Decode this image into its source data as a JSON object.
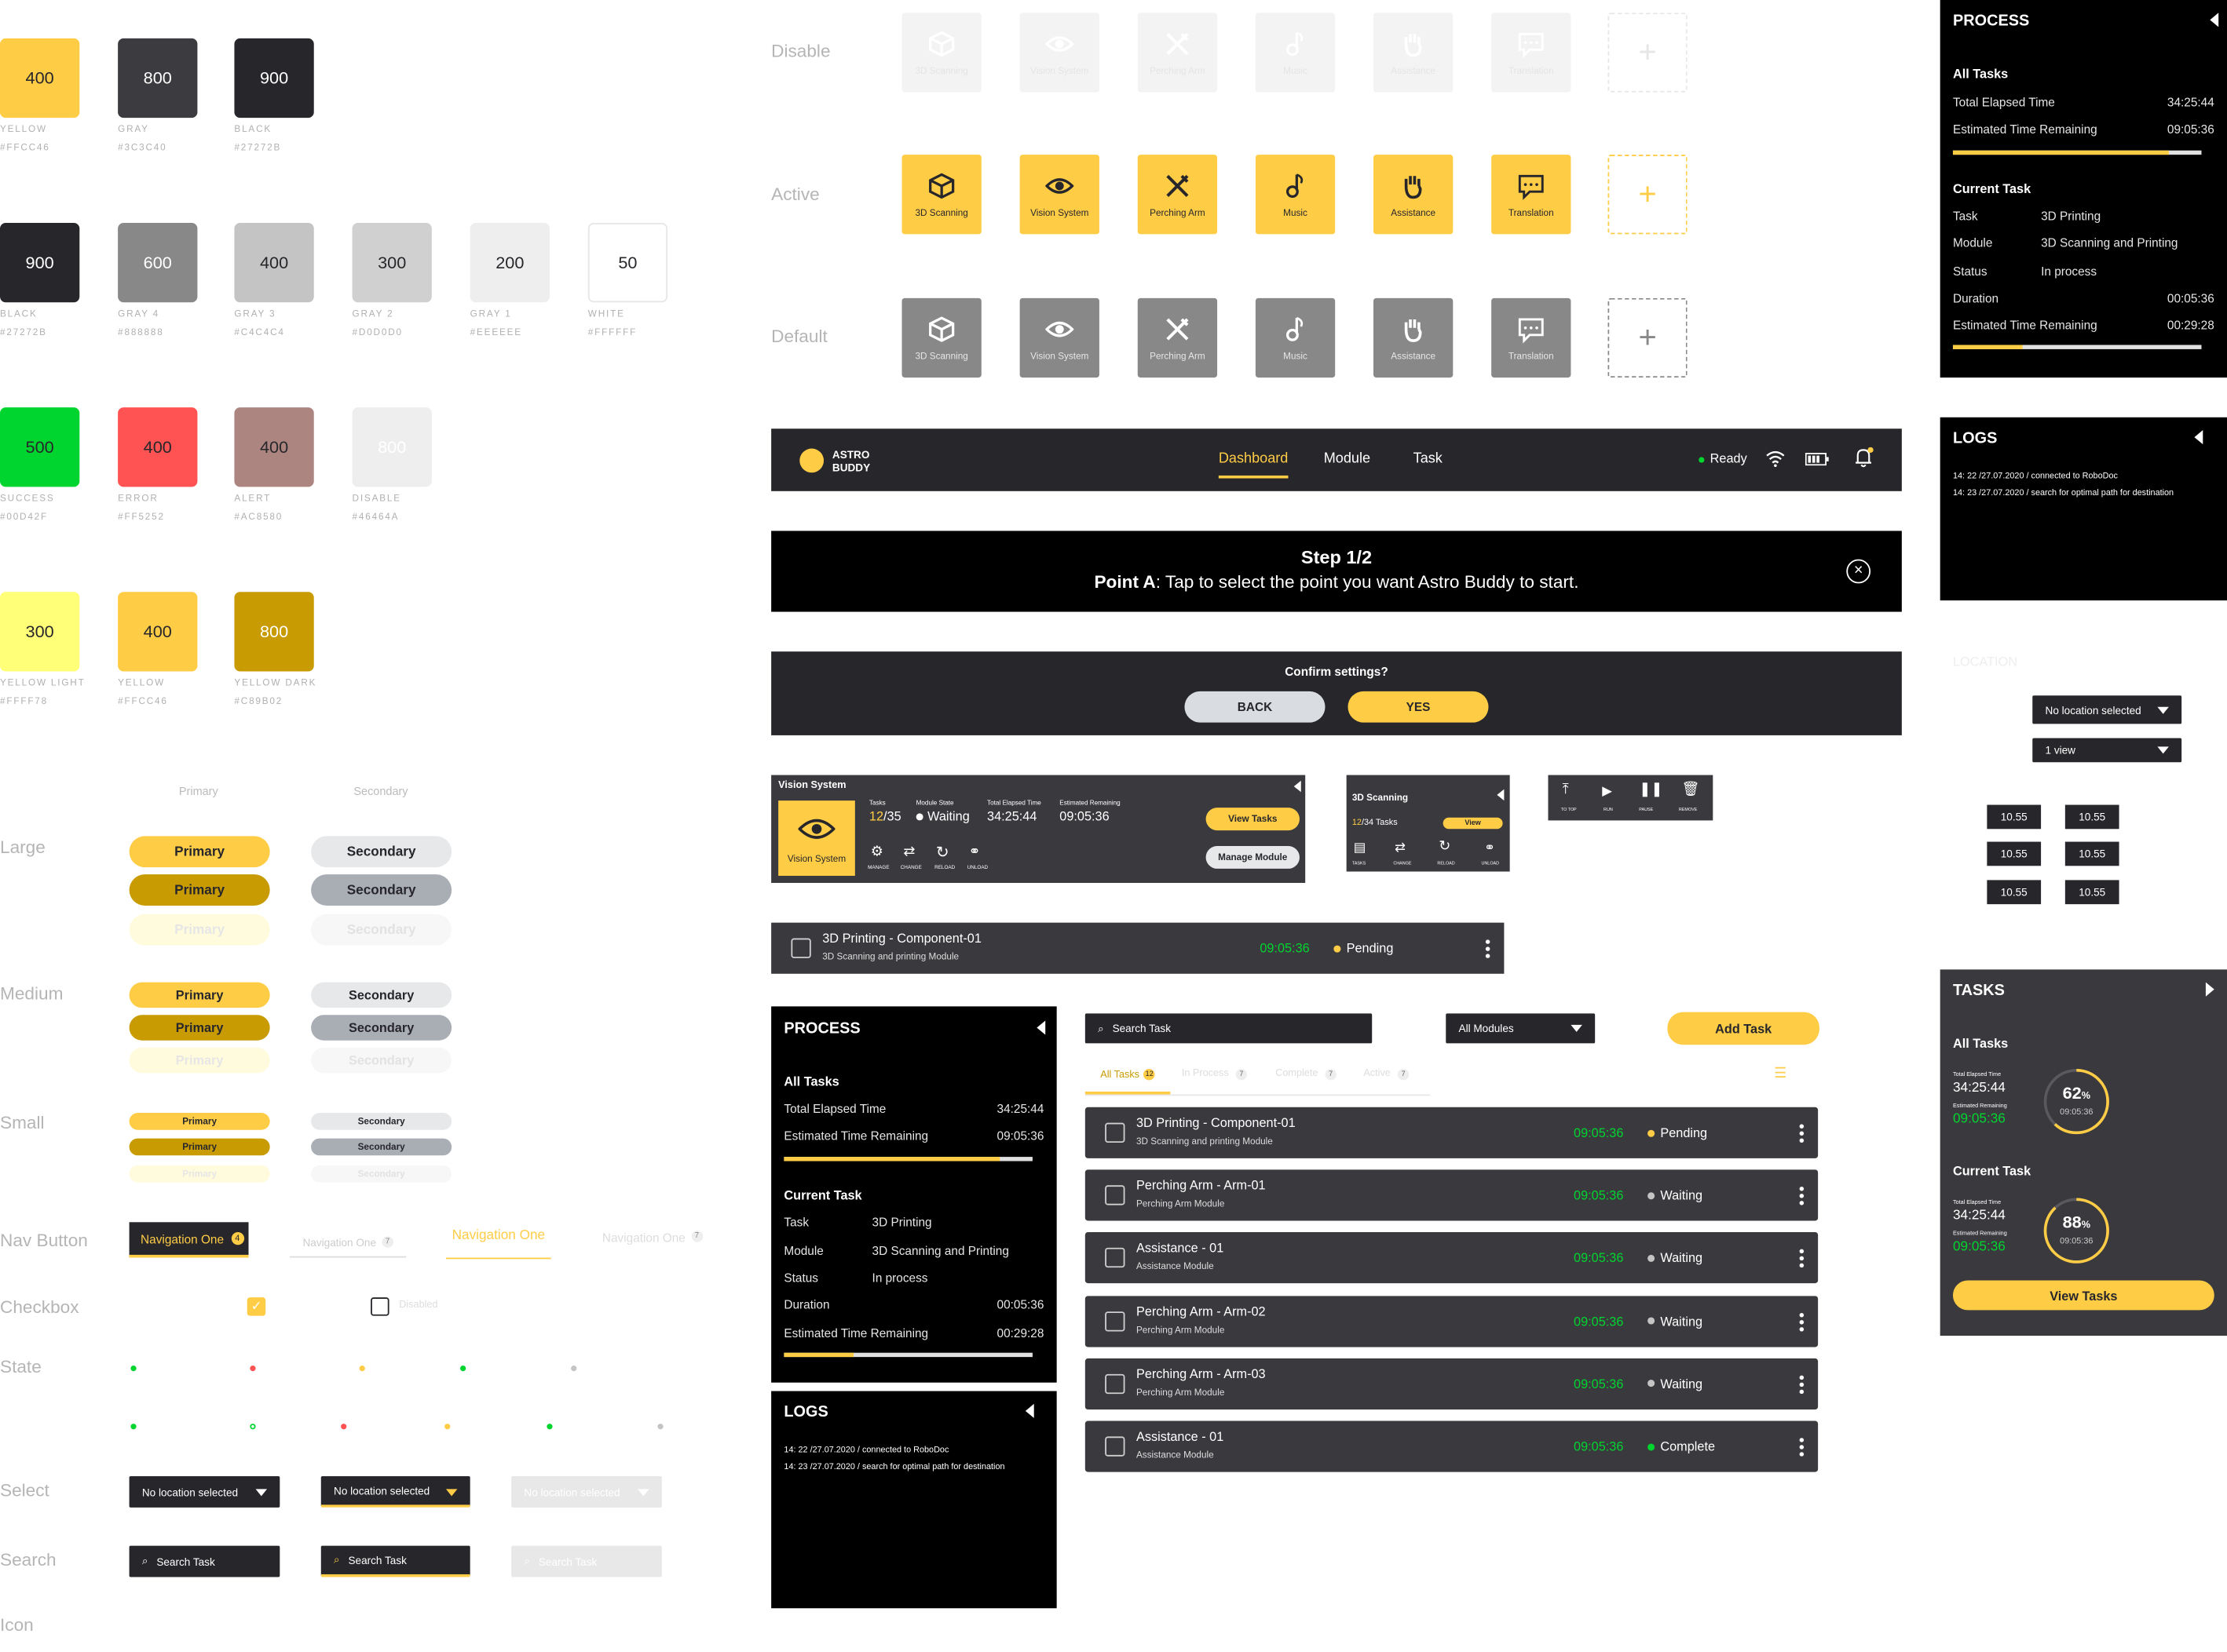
{
  "colors": {
    "yellow": "#FFCC46",
    "gray": "#3C3C40",
    "black": "#27272B",
    "gray4": "#888888",
    "gray3": "#C4C4C4",
    "gray2": "#D0D0D0",
    "gray1": "#EEEEEE",
    "white": "#FFFFFF",
    "success": "#00D42F",
    "error": "#FF5252",
    "alert": "#AC8580",
    "disable": "#46464A",
    "yellow_light": "#FFFF78",
    "yellow_dark": "#C89B02"
  },
  "swatches": [
    {
      "num": "400",
      "name": "YELLOW",
      "hex": "#FFCC46"
    },
    {
      "num": "800",
      "name": "GRAY",
      "hex": "#3C3C40"
    },
    {
      "num": "900",
      "name": "BLACK",
      "hex": "#27272B"
    },
    {
      "num": "900",
      "name": "BLACK",
      "hex": "#27272B"
    },
    {
      "num": "600",
      "name": "GRAY 4",
      "hex": "#888888"
    },
    {
      "num": "400",
      "name": "GRAY 3",
      "hex": "#C4C4C4"
    },
    {
      "num": "300",
      "name": "GRAY 2",
      "hex": "#D0D0D0"
    },
    {
      "num": "200",
      "name": "GRAY 1",
      "hex": "#EEEEEE"
    },
    {
      "num": "50",
      "name": "WHITE",
      "hex": "#FFFFFF"
    },
    {
      "num": "500",
      "name": "SUCCESS",
      "hex": "#00D42F"
    },
    {
      "num": "400",
      "name": "ERROR",
      "hex": "#FF5252"
    },
    {
      "num": "400",
      "name": "ALERT",
      "hex": "#AC8580"
    },
    {
      "num": "800",
      "name": "DISABLE",
      "hex": "#46464A"
    },
    {
      "num": "300",
      "name": "YELLOW LIGHT",
      "hex": "#FFFF78"
    },
    {
      "num": "400",
      "name": "YELLOW",
      "hex": "#FFCC46"
    },
    {
      "num": "800",
      "name": "YELLOW DARK",
      "hex": "#C89B02"
    }
  ],
  "buttons": {
    "col_primary": "Primary",
    "col_secondary": "Secondary",
    "large": "Large",
    "medium": "Medium",
    "small": "Small",
    "primary": "Primary",
    "secondary": "Secondary"
  },
  "rows": {
    "nav": "Nav Button",
    "checkbox": "Checkbox",
    "state": "State",
    "select": "Select",
    "search": "Search",
    "icon": "Icon"
  },
  "nav_buttons": {
    "label": "Navigation One",
    "badge": "4",
    "badge2": "7"
  },
  "checkbox": {
    "disabled": "Disabled"
  },
  "select": {
    "value": "No location selected"
  },
  "search": {
    "placeholder": "Search Task"
  },
  "icon_states": {
    "disable": "Disable",
    "active": "Active",
    "default": "Default"
  },
  "icons": [
    {
      "label": "3D Scanning",
      "icon": "cube-icon"
    },
    {
      "label": "Vision System",
      "icon": "eye-icon"
    },
    {
      "label": "Perching Arm",
      "icon": "tools-icon"
    },
    {
      "label": "Music",
      "icon": "music-icon"
    },
    {
      "label": "Assistance",
      "icon": "hand-icon"
    },
    {
      "label": "Translation",
      "icon": "chat-icon"
    }
  ],
  "navbar": {
    "logo_line1": "ASTRO",
    "logo_line2": "BUDDY",
    "tabs": [
      "Dashboard",
      "Module",
      "Task"
    ],
    "active_tab": "Dashboard",
    "status": "Ready"
  },
  "step": {
    "title": "Step 1/2",
    "point": "Point A",
    "text": ": Tap to select the point you want Astro Buddy to start."
  },
  "confirm": {
    "question": "Confirm settings?",
    "back": "BACK",
    "yes": "YES"
  },
  "module_card": {
    "title": "Vision System",
    "tile_label": "Vision System",
    "tasks_label": "Tasks",
    "tasks_done": "12",
    "tasks_total": "/35",
    "state_label": "Module State",
    "state": "Waiting",
    "elapsed_label": "Total Elapsed Time",
    "elapsed": "34:25:44",
    "remaining_label": "Estimated Remaining",
    "remaining": "09:05:36",
    "view_tasks": "View Tasks",
    "manage": "Manage Module",
    "actions": [
      "MANAGE",
      "CHANGE",
      "RELOAD",
      "UNLOAD"
    ]
  },
  "small_card": {
    "title": "3D Scanning",
    "done": "12",
    "rest": "/34 Tasks",
    "view": "View",
    "actions": [
      "TASKS",
      "CHANGE",
      "RELOAD",
      "UNLOAD"
    ]
  },
  "controls": [
    "TO TOP",
    "RUN",
    "PAUSE",
    "REMOVE"
  ],
  "single_task": {
    "title": "3D Printing - Component-01",
    "sub": "3D Scanning and printing Module",
    "time": "09:05:36",
    "status": "Pending"
  },
  "process": {
    "title": "PROCESS",
    "all_tasks": "All Tasks",
    "elapsed_label": "Total Elapsed Time",
    "elapsed": "34:25:44",
    "remaining_label": "Estimated Time Remaining",
    "remaining": "09:05:36",
    "all_progress": 0.87,
    "current": "Current Task",
    "task_label": "Task",
    "task": "3D Printing",
    "module_label": "Module",
    "module": "3D Scanning and Printing",
    "status_label": "Status",
    "status": "In process",
    "duration_label": "Duration",
    "duration": "00:05:36",
    "cur_remaining_label": "Estimated Time Remaining",
    "cur_remaining": "00:29:28",
    "cur_progress": 0.28
  },
  "logs": {
    "title": "LOGS",
    "line1": "14: 22 /27.07.2020 / connected to RoboDoc",
    "line2": "14: 23 /27.07.2020 / search for optimal path for destination"
  },
  "location": {
    "label": "LOCATION",
    "select": "No location selected",
    "view": "1 view",
    "times": [
      "10.55",
      "10.55",
      "10.55",
      "10.55",
      "10.55",
      "10.55"
    ]
  },
  "task_list": {
    "search": "Search Task",
    "modules": "All Modules",
    "add": "Add Task",
    "tabs": [
      {
        "label": "All Tasks",
        "count": "12"
      },
      {
        "label": "In Process",
        "count": "7"
      },
      {
        "label": "Complete",
        "count": "7"
      },
      {
        "label": "Active",
        "count": "7"
      }
    ],
    "items": [
      {
        "title": "3D Printing - Component-01",
        "sub": "3D Scanning and printing Module",
        "time": "09:05:36",
        "status": "Pending",
        "color": "#FFCC46"
      },
      {
        "title": "Perching Arm - Arm-01",
        "sub": "Perching Arm Module",
        "time": "09:05:36",
        "status": "Waiting",
        "color": "#C4C4C4"
      },
      {
        "title": "Assistance - 01",
        "sub": "Assistance Module",
        "time": "09:05:36",
        "status": "Waiting",
        "color": "#C4C4C4"
      },
      {
        "title": "Perching Arm - Arm-02",
        "sub": "Perching Arm Module",
        "time": "09:05:36",
        "status": "Waiting",
        "color": "#C4C4C4"
      },
      {
        "title": "Perching Arm - Arm-03",
        "sub": "Perching Arm Module",
        "time": "09:05:36",
        "status": "Waiting",
        "color": "#C4C4C4"
      },
      {
        "title": "Assistance - 01",
        "sub": "Assistance Module",
        "time": "09:05:36",
        "status": "Complete",
        "color": "#00D42F"
      }
    ]
  },
  "tasks_panel": {
    "title": "TASKS",
    "all": "All Tasks",
    "elapsed_label": "Total Elapsed Time",
    "elapsed": "34:25:44",
    "remaining_label": "Estimated Remaining",
    "remaining": "09:05:36",
    "pct1": "62",
    "pct1_value": 0.62,
    "current": "Current Task",
    "pct2": "88",
    "pct2_value": 0.88,
    "ring_time": "09:05:36",
    "view": "View Tasks"
  }
}
